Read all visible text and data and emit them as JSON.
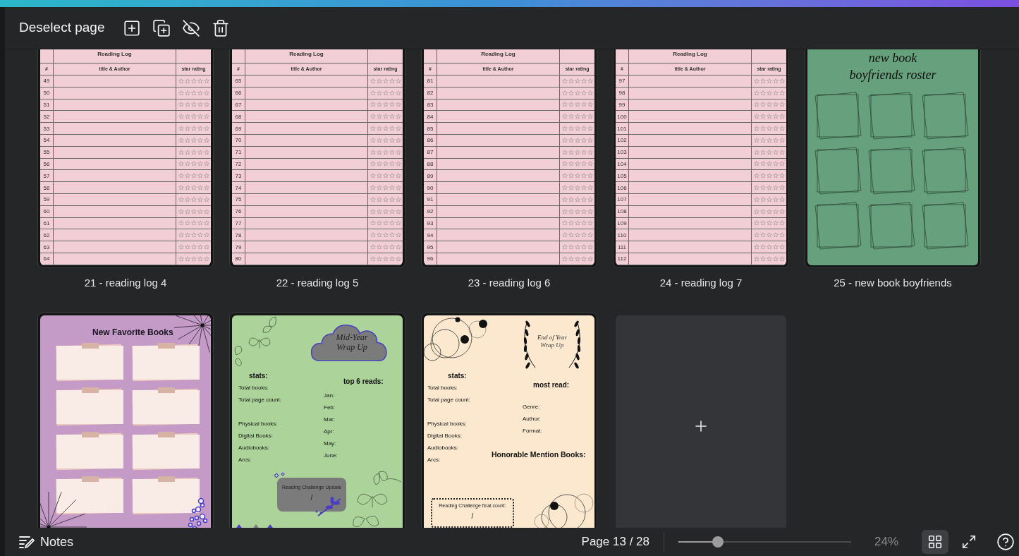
{
  "toolbar": {
    "deselect": "Deselect page"
  },
  "pages": [
    {
      "kind": "reading_log",
      "label": "21 - reading log 4",
      "title": "Reading Log",
      "columns": [
        "#",
        "title & Author",
        "star rating"
      ],
      "rows": [
        {
          "number": "49",
          "stars": 0
        },
        {
          "number": "50",
          "stars": 0
        },
        {
          "number": "51",
          "stars": 0
        },
        {
          "number": "52",
          "stars": 0
        },
        {
          "number": "53",
          "stars": 0
        },
        {
          "number": "54",
          "stars": 0
        },
        {
          "number": "55",
          "stars": 0
        },
        {
          "number": "56",
          "stars": 0
        },
        {
          "number": "57",
          "stars": 0
        },
        {
          "number": "58",
          "stars": 0
        },
        {
          "number": "59",
          "stars": 0
        },
        {
          "number": "60",
          "stars": 0
        },
        {
          "number": "61",
          "stars": 0
        },
        {
          "number": "62",
          "stars": 0
        },
        {
          "number": "63",
          "stars": 0
        },
        {
          "number": "64",
          "stars": 0
        }
      ]
    },
    {
      "kind": "reading_log",
      "label": "22 - reading log 5",
      "title": "Reading Log",
      "columns": [
        "#",
        "title & Author",
        "star rating"
      ],
      "rows": [
        {
          "number": "65",
          "stars": 0
        },
        {
          "number": "66",
          "stars": 0
        },
        {
          "number": "67",
          "stars": 0
        },
        {
          "number": "68",
          "stars": 0
        },
        {
          "number": "69",
          "stars": 0
        },
        {
          "number": "70",
          "stars": 0
        },
        {
          "number": "71",
          "stars": 0
        },
        {
          "number": "72",
          "stars": 0
        },
        {
          "number": "73",
          "stars": 0
        },
        {
          "number": "74",
          "stars": 0
        },
        {
          "number": "75",
          "stars": 0
        },
        {
          "number": "76",
          "stars": 0
        },
        {
          "number": "77",
          "stars": 0
        },
        {
          "number": "78",
          "stars": 0
        },
        {
          "number": "79",
          "stars": 0
        },
        {
          "number": "80",
          "stars": 0
        }
      ]
    },
    {
      "kind": "reading_log",
      "label": "23 - reading log 6",
      "title": "Reading Log",
      "columns": [
        "#",
        "title & Author",
        "star rating"
      ],
      "rows": [
        {
          "number": "81",
          "stars": 0
        },
        {
          "number": "82",
          "stars": 0
        },
        {
          "number": "83",
          "stars": 0
        },
        {
          "number": "84",
          "stars": 0
        },
        {
          "number": "85",
          "stars": 0
        },
        {
          "number": "86",
          "stars": 0
        },
        {
          "number": "87",
          "stars": 0
        },
        {
          "number": "88",
          "stars": 0
        },
        {
          "number": "89",
          "stars": 0
        },
        {
          "number": "90",
          "stars": 0
        },
        {
          "number": "91",
          "stars": 0
        },
        {
          "number": "92",
          "stars": 0
        },
        {
          "number": "93",
          "stars": 0
        },
        {
          "number": "94",
          "stars": 0
        },
        {
          "number": "95",
          "stars": 0
        },
        {
          "number": "96",
          "stars": 0
        }
      ]
    },
    {
      "kind": "reading_log",
      "label": "24 - reading log 7",
      "title": "Reading Log",
      "columns": [
        "#",
        "title & Author",
        "star rating"
      ],
      "rows": [
        {
          "number": "97",
          "stars": 0
        },
        {
          "number": "98",
          "stars": 0
        },
        {
          "number": "99",
          "stars": 0
        },
        {
          "number": "100",
          "stars": 0
        },
        {
          "number": "101",
          "stars": 0
        },
        {
          "number": "102",
          "stars": 0
        },
        {
          "number": "103",
          "stars": 0
        },
        {
          "number": "104",
          "stars": 0
        },
        {
          "number": "105",
          "stars": 0
        },
        {
          "number": "106",
          "stars": 0
        },
        {
          "number": "107",
          "stars": 0
        },
        {
          "number": "108",
          "stars": 0
        },
        {
          "number": "109",
          "stars": 0
        },
        {
          "number": "110",
          "stars": 0
        },
        {
          "number": "111",
          "stars": 0
        },
        {
          "number": "112",
          "stars": 0
        }
      ]
    },
    {
      "kind": "roster",
      "label": "25 - new book boyfriends",
      "title_lines": [
        "new book",
        "boyfriends roster"
      ]
    },
    {
      "kind": "favorites",
      "title": "New Favorite Books"
    },
    {
      "kind": "mid_year",
      "title_lines": [
        "Mid-Year",
        "Wrap Up"
      ],
      "stats_heading": "stats:",
      "stats": [
        "Total books:",
        "Total page count:",
        "Physical books:",
        "Digital Books:",
        "Audiobooks:",
        "Arcs:"
      ],
      "reads_heading": "top 6 reads:",
      "months": [
        "Jan:",
        "Feb:",
        "Mar:",
        "Apr:",
        "May:",
        "June:"
      ],
      "challenge": "Reading Challenge Update",
      "challenge_value": "/"
    },
    {
      "kind": "end_year",
      "title_lines": [
        "End of Year",
        "Wrap Up"
      ],
      "stats_heading": "stats:",
      "stats": [
        "Total books:",
        "Total page count:",
        "Physical books:",
        "Digital Books:",
        "Audiobooks:",
        "Arcs:"
      ],
      "most_heading": "most read:",
      "most": [
        "Genre:",
        "Author:",
        "Format:"
      ],
      "honorable": "Honorable Mention Books:",
      "challenge": "Reading Challenge final count:",
      "challenge_value": "/"
    },
    {
      "kind": "add_page"
    }
  ],
  "bottom_bar": {
    "notes": "Notes",
    "page": "Page 13 / 28",
    "zoom": {
      "level": 0.23
    },
    "zoom_reading": "24%",
    "views": [
      {
        "kind": "grid",
        "selected": true
      },
      {
        "kind": "fullscreen",
        "selected": false
      }
    ]
  }
}
